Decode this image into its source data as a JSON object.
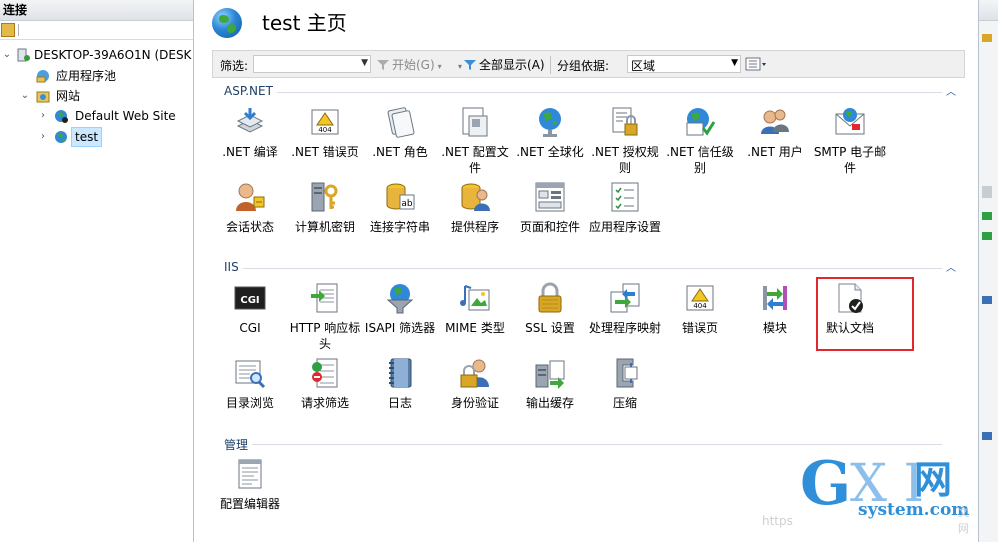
{
  "connections": {
    "title": "连接",
    "tree": [
      {
        "label": "DESKTOP-39A6O1N (DESK",
        "icon": "server-icon"
      },
      {
        "label": "应用程序池",
        "icon": "app-pool-icon"
      },
      {
        "label": "网站",
        "icon": "sites-folder-icon"
      },
      {
        "label": "Default Web Site",
        "icon": "globe-icon"
      },
      {
        "label": "test",
        "icon": "globe-icon",
        "selected": true
      }
    ]
  },
  "header": {
    "title": "test 主页"
  },
  "filterbar": {
    "filter_label": "筛选:",
    "filter_value": "",
    "start_label": "开始(G)",
    "show_all_label": "全部显示(A)",
    "group_label": "分组依据:",
    "group_value": "区域"
  },
  "sections": [
    {
      "name": "ASP.NET",
      "features": [
        {
          "label": ".NET 编译",
          "icon": "net-compilation-icon"
        },
        {
          "label": ".NET 错误页",
          "icon": "net-error-pages-icon"
        },
        {
          "label": ".NET 角色",
          "icon": "net-roles-icon"
        },
        {
          "label": ".NET 配置文件",
          "icon": "net-profile-icon"
        },
        {
          "label": ".NET 全球化",
          "icon": "net-globalization-icon"
        },
        {
          "label": ".NET 授权规则",
          "icon": "net-authorization-icon"
        },
        {
          "label": ".NET 信任级别",
          "icon": "net-trust-levels-icon"
        },
        {
          "label": ".NET 用户",
          "icon": "net-users-icon"
        },
        {
          "label": "SMTP 电子邮件",
          "icon": "smtp-email-icon"
        },
        {
          "label": "会话状态",
          "icon": "session-state-icon"
        },
        {
          "label": "计算机密钥",
          "icon": "machine-key-icon"
        },
        {
          "label": "连接字符串",
          "icon": "connection-strings-icon"
        },
        {
          "label": "提供程序",
          "icon": "providers-icon"
        },
        {
          "label": "页面和控件",
          "icon": "pages-controls-icon"
        },
        {
          "label": "应用程序设置",
          "icon": "app-settings-icon"
        }
      ]
    },
    {
      "name": "IIS",
      "features": [
        {
          "label": "CGI",
          "icon": "cgi-icon"
        },
        {
          "label": "HTTP 响应标头",
          "icon": "http-response-headers-icon"
        },
        {
          "label": "ISAPI 筛选器",
          "icon": "isapi-filters-icon"
        },
        {
          "label": "MIME 类型",
          "icon": "mime-types-icon"
        },
        {
          "label": "SSL 设置",
          "icon": "ssl-settings-icon"
        },
        {
          "label": "处理程序映射",
          "icon": "handler-mappings-icon"
        },
        {
          "label": "错误页",
          "icon": "error-pages-icon"
        },
        {
          "label": "模块",
          "icon": "modules-icon"
        },
        {
          "label": "默认文档",
          "icon": "default-document-icon"
        },
        {
          "label": "目录浏览",
          "icon": "directory-browsing-icon"
        },
        {
          "label": "请求筛选",
          "icon": "request-filtering-icon"
        },
        {
          "label": "日志",
          "icon": "logging-icon"
        },
        {
          "label": "身份验证",
          "icon": "authentication-icon"
        },
        {
          "label": "输出缓存",
          "icon": "output-caching-icon"
        },
        {
          "label": "压缩",
          "icon": "compression-icon"
        }
      ]
    },
    {
      "name": "管理",
      "features": [
        {
          "label": "配置编辑器",
          "icon": "configuration-editor-icon"
        }
      ]
    }
  ],
  "watermark": {
    "g": "G",
    "xi": "X I",
    "wang": "网",
    "domain": "system.com",
    "https": "https",
    "wen": "文网"
  },
  "colors": {
    "accent": "#1f3f68",
    "highlight": "#e0282e",
    "selection": "#cce8ff"
  }
}
